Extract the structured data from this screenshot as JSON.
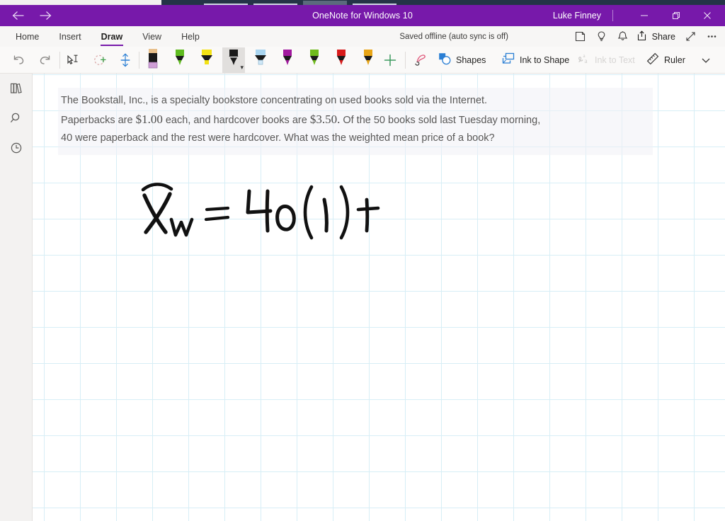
{
  "titlebar": {
    "app_title": "OneNote for Windows 10",
    "account_name": "Luke Finney",
    "back_icon": "arrow-left-icon",
    "forward_icon": "arrow-right-icon",
    "minimize_label": "Minimize",
    "maximize_label": "Restore",
    "close_label": "Close",
    "bg_color": "#7719aa"
  },
  "ribbon": {
    "tabs": [
      {
        "label": "Home",
        "active": false
      },
      {
        "label": "Insert",
        "active": false
      },
      {
        "label": "Draw",
        "active": true
      },
      {
        "label": "View",
        "active": false
      },
      {
        "label": "Help",
        "active": false
      }
    ],
    "active_tab": "Draw",
    "accent_color": "#7719aa",
    "save_status": "Saved offline (auto sync is off)",
    "share_label": "Share",
    "icons": [
      "sticky-note-icon",
      "lightbulb-icon",
      "bell-icon",
      "share-icon",
      "expand-icon",
      "more-options-icon"
    ]
  },
  "drawbar": {
    "undo_label": "Undo",
    "redo_label": "Redo",
    "lasso_label": "Lasso Select",
    "eraser_label": "Eraser",
    "stroke_label": "Ink Thickness",
    "add_pen_label": "Add Pen",
    "ink_replay_label": "Ink Replay",
    "shapes_label": "Shapes",
    "ink_to_shape_label": "Ink to Shape",
    "ink_to_text_label": "Ink to Text",
    "ink_to_text_enabled": false,
    "ruler_label": "Ruler",
    "overflow_label": "More",
    "pens": [
      {
        "name": "pencil",
        "type": "pencil",
        "body": "#1a1a1a",
        "tip": "#e8c08c",
        "accent": "#cf9fd6",
        "selected": false
      },
      {
        "name": "green-pen",
        "type": "pen",
        "body": "#1a1a1a",
        "tip": "#5fbb1f",
        "accent": "#5fbb1f",
        "selected": false
      },
      {
        "name": "yellow-highlighter",
        "type": "highlighter",
        "body": "#1a1a1a",
        "tip": "#f3e215",
        "accent": "#f3e215",
        "selected": false
      },
      {
        "name": "black-pen",
        "type": "pen",
        "body": "#1a1a1a",
        "tip": "#1a1a1a",
        "accent": "#1a1a1a",
        "selected": true
      },
      {
        "name": "blue-highlighter",
        "type": "highlighter",
        "body": "#1a1a1a",
        "tip": "#a9d5f0",
        "accent": "#a9d5f0",
        "selected": false
      },
      {
        "name": "purple-pen",
        "type": "pen",
        "body": "#1a1a1a",
        "tip": "#a1199e",
        "accent": "#a1199e",
        "selected": false
      },
      {
        "name": "lime-pen",
        "type": "pen",
        "body": "#1a1a1a",
        "tip": "#6fbb1c",
        "accent": "#6fbb1c",
        "selected": false
      },
      {
        "name": "red-pen",
        "type": "pen",
        "body": "#1a1a1a",
        "tip": "#d81c1c",
        "accent": "#d81c1c",
        "selected": false
      },
      {
        "name": "orange-pen",
        "type": "pen",
        "body": "#1a1a1a",
        "tip": "#e8a516",
        "accent": "#e8a516",
        "selected": false
      }
    ]
  },
  "rail": {
    "items": [
      {
        "icon": "notebooks-icon",
        "label": "Notebooks"
      },
      {
        "icon": "search-icon",
        "label": "Search"
      },
      {
        "icon": "recent-clock-icon",
        "label": "Recent Notes"
      }
    ]
  },
  "page": {
    "grid_color": "#bfe4f2",
    "grid_size_px": 51,
    "textbox": {
      "line1_a": "The Bookstall, Inc., is a specialty bookstore concentrating on used books sold via the Internet.",
      "line2_a": "Paperbacks are ",
      "line2_money1": "$1.00",
      "line2_b": " each, and hardcover books are ",
      "line2_money2": "$3.50.",
      "line2_c": " Of the 50 books sold last Tuesday morning,",
      "line3_a": "40 were paperback and the rest were hardcover. What was the weighted mean price of a book?"
    },
    "ink": {
      "description": "handwritten-equation",
      "transcription": "X̄w  =   40(1)  +",
      "color": "#111111"
    }
  }
}
